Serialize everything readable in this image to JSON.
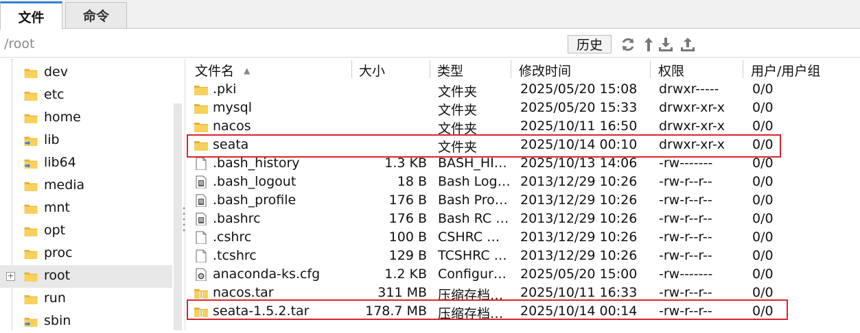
{
  "tabs": [
    {
      "label": "文件"
    },
    {
      "label": "命令"
    }
  ],
  "pathbar": {
    "path": "/root",
    "history_label": "历史"
  },
  "tree": {
    "items": [
      {
        "label": "dev",
        "icon": "folder-icon"
      },
      {
        "label": "etc",
        "icon": "folder-icon"
      },
      {
        "label": "home",
        "icon": "folder-icon"
      },
      {
        "label": "lib",
        "icon": "folder-link-icon"
      },
      {
        "label": "lib64",
        "icon": "folder-link-icon"
      },
      {
        "label": "media",
        "icon": "folder-icon"
      },
      {
        "label": "mnt",
        "icon": "folder-icon"
      },
      {
        "label": "opt",
        "icon": "folder-icon"
      },
      {
        "label": "proc",
        "icon": "folder-icon"
      },
      {
        "label": "root",
        "icon": "folder-icon",
        "selected": true,
        "expander": "+"
      },
      {
        "label": "run",
        "icon": "folder-icon"
      },
      {
        "label": "sbin",
        "icon": "folder-link-icon"
      }
    ]
  },
  "table": {
    "columns": [
      "文件名",
      "大小",
      "类型",
      "修改时间",
      "权限",
      "用户/用户组"
    ],
    "sort_indicator": "▲",
    "rows": [
      {
        "name": ".pki",
        "size": "",
        "type": "文件夹",
        "mtime": "2025/05/20 15:08",
        "perm": "drwxr-----",
        "owner": "0/0",
        "icon": "folder-icon"
      },
      {
        "name": "mysql",
        "size": "",
        "type": "文件夹",
        "mtime": "2025/05/20 15:33",
        "perm": "drwxr-xr-x",
        "owner": "0/0",
        "icon": "folder-icon"
      },
      {
        "name": "nacos",
        "size": "",
        "type": "文件夹",
        "mtime": "2025/10/11 16:50",
        "perm": "drwxr-xr-x",
        "owner": "0/0",
        "icon": "folder-icon"
      },
      {
        "name": "seata",
        "size": "",
        "type": "文件夹",
        "mtime": "2025/10/14 00:10",
        "perm": "drwxr-xr-x",
        "owner": "0/0",
        "icon": "folder-icon"
      },
      {
        "name": ".bash_history",
        "size": "1.3 KB",
        "type": "BASH_HI…",
        "mtime": "2025/10/13 14:06",
        "perm": "-rw-------",
        "owner": "0/0",
        "icon": "file-icon"
      },
      {
        "name": ".bash_logout",
        "size": "18 B",
        "type": "Bash Log…",
        "mtime": "2013/12/29 10:26",
        "perm": "-rw-r--r--",
        "owner": "0/0",
        "icon": "script-file-icon"
      },
      {
        "name": ".bash_profile",
        "size": "176 B",
        "type": "Bash Pro…",
        "mtime": "2013/12/29 10:26",
        "perm": "-rw-r--r--",
        "owner": "0/0",
        "icon": "script-file-icon"
      },
      {
        "name": ".bashrc",
        "size": "176 B",
        "type": "Bash RC …",
        "mtime": "2013/12/29 10:26",
        "perm": "-rw-r--r--",
        "owner": "0/0",
        "icon": "script-file-icon"
      },
      {
        "name": ".cshrc",
        "size": "100 B",
        "type": "CSHRC …",
        "mtime": "2013/12/29 10:26",
        "perm": "-rw-r--r--",
        "owner": "0/0",
        "icon": "file-icon"
      },
      {
        "name": ".tcshrc",
        "size": "129 B",
        "type": "TCSHRC …",
        "mtime": "2013/12/29 10:26",
        "perm": "-rw-r--r--",
        "owner": "0/0",
        "icon": "file-icon"
      },
      {
        "name": "anaconda-ks.cfg",
        "size": "1.2 KB",
        "type": "Configur…",
        "mtime": "2025/05/20 15:00",
        "perm": "-rw-------",
        "owner": "0/0",
        "icon": "config-file-icon"
      },
      {
        "name": "nacos.tar",
        "size": "311 MB",
        "type": "压缩存档…",
        "mtime": "2025/10/11 16:33",
        "perm": "-rw-r--r--",
        "owner": "0/0",
        "icon": "archive-icon"
      },
      {
        "name": "seata-1.5.2.tar",
        "size": "178.7 MB",
        "type": "压缩存档…",
        "mtime": "2025/10/14 00:14",
        "perm": "-rw-r--r--",
        "owner": "0/0",
        "icon": "archive-icon"
      }
    ]
  },
  "colors": {
    "highlight_box": "#d9232d",
    "folder": "#f5c94a",
    "tab_accent": "#2f7fd8"
  }
}
